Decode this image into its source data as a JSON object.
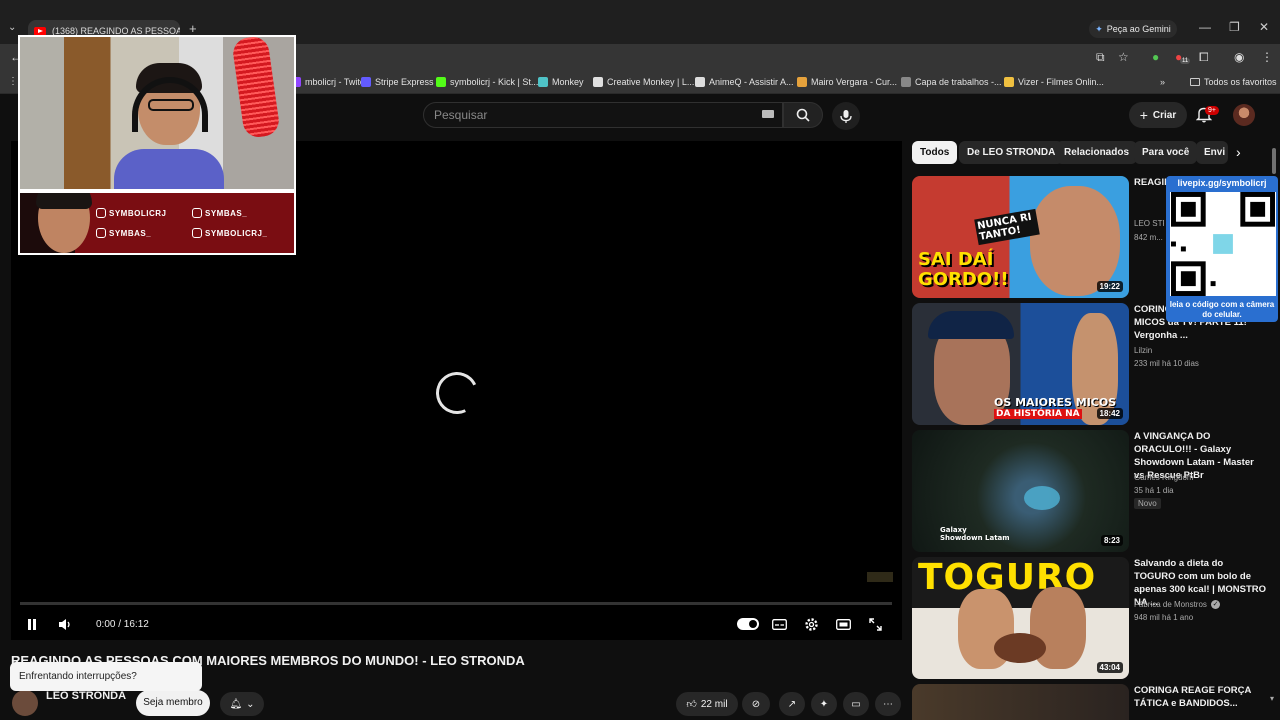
{
  "browser": {
    "tab_title": "(1368) REAGINDO AS PESSOAS",
    "new_tab": "+",
    "gemini_label": "Peça ao Gemini",
    "bookmarks": [
      {
        "label": "mbolicrj - Twitch",
        "color": "#9146ff"
      },
      {
        "label": "Stripe Express",
        "color": "#635bff"
      },
      {
        "label": "symbolicrj - Kick | St...",
        "color": "#53fc18"
      },
      {
        "label": "Monkey",
        "color": "#4fc3c7"
      },
      {
        "label": "Creative Monkey | L...",
        "color": "#e0e0e0"
      },
      {
        "label": "AnimeQ - Assistir A...",
        "color": "#dddddd"
      },
      {
        "label": "Mairo Vergara - Cur...",
        "color": "#e6a23c"
      },
      {
        "label": "Capa de trabalhos -...",
        "color": "#888888"
      },
      {
        "label": "Vizer - Filmes Onlin...",
        "color": "#f0c040"
      }
    ],
    "all_bookmarks": "Todos os favoritos",
    "ext_badge": "11"
  },
  "header": {
    "search_placeholder": "Pesquisar",
    "create_label": "Criar",
    "notif_badge": "9+"
  },
  "player": {
    "time_current": "0:00",
    "time_total": "16:12",
    "time_text": "0:00 / 16:12",
    "progress": 0.0
  },
  "overlay": {
    "social": [
      "SYMBOLICRJ",
      "SYMBAS_",
      "SYMBAS_",
      "SYMBOLICRJ_"
    ]
  },
  "video": {
    "title": "REAGINDO AS PESSOAS COM MAIORES MEMBROS DO MUNDO! - LEO STRONDA",
    "channel": "LEO STRONDA",
    "member_label": "Seja membro",
    "likes": "22 mil",
    "toast": "Enfrentando interrupções?"
  },
  "sidebar": {
    "chips": [
      "Todos",
      "De LEO STRONDA",
      "Relacionados",
      "Para você",
      "Envi"
    ],
    "videos": [
      {
        "title": "REAGINDO ... MAIS E... ESPORT...",
        "channel": "LEO STR...",
        "meta": "842 m...",
        "duration": "19:22",
        "thumb_text_1": "SAI DAÍ",
        "thumb_text_2": "GORDO!!",
        "thumb_text_3": "NUNCA RI TANTO!"
      },
      {
        "title": "CORING... Maiores e PIORES MICOS da TV! PARTE 11! Vergonha ...",
        "channel": "Lilzin",
        "meta": "233 mil   há 10 dias",
        "duration": "18:42",
        "thumb_text_1": "OS MAIORES MICOS",
        "thumb_text_2": "DA HISTÓRIA NA"
      },
      {
        "title": "A VINGANÇA DO ORACULO!!! - Galaxy Showdown Latam - Master vs Rescue PtBr",
        "channel": "Games Kingdom",
        "meta": "35   há 1 dia",
        "badge": "Novo",
        "duration": "8:23",
        "thumb_text_1": "Galaxy Showdown Latam"
      },
      {
        "title": "Salvando a dieta do TOGURO com um bolo de apenas 300 kcal! | MONSTRO NA ...",
        "channel": "Fábrica de Monstros",
        "meta": "948 mil   há 1 ano",
        "duration": "43:04",
        "thumb_text_1": "TOGURO"
      },
      {
        "title": "CORINGA REAGE FORÇA TÁTICA e BANDIDOS...",
        "channel": "",
        "meta": "",
        "duration": ""
      }
    ]
  },
  "qr": {
    "url": "livepix.gg/symbolicrj",
    "caption": "leia o código com a câmera do celular."
  }
}
